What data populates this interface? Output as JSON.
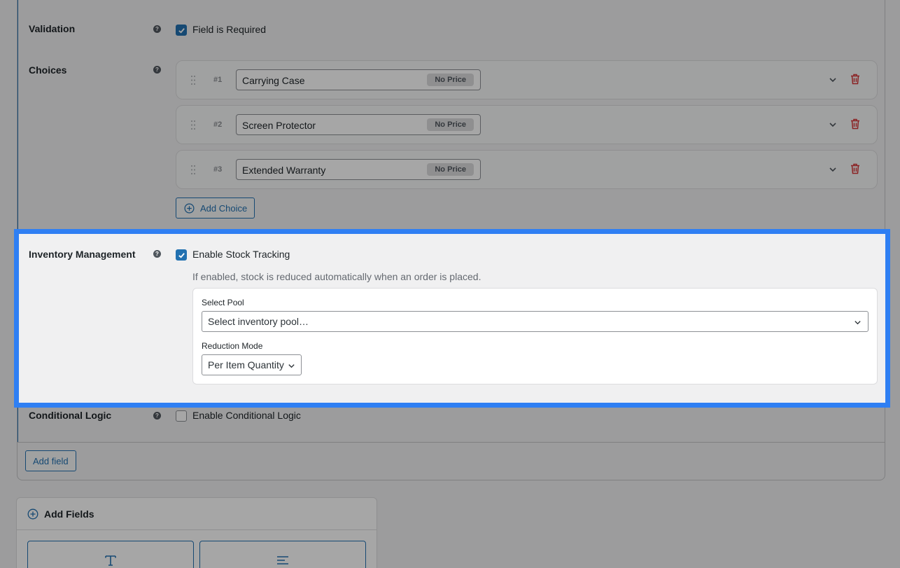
{
  "validation": {
    "label": "Validation",
    "checkbox_label": "Field is Required",
    "checked": true
  },
  "choices": {
    "label": "Choices",
    "items": [
      {
        "number": "#1",
        "value": "Carrying Case",
        "price": "No Price"
      },
      {
        "number": "#2",
        "value": "Screen Protector",
        "price": "No Price"
      },
      {
        "number": "#3",
        "value": "Extended Warranty",
        "price": "No Price"
      }
    ],
    "add_label": "Add Choice"
  },
  "inventory": {
    "label": "Inventory Management",
    "checkbox_label": "Enable Stock Tracking",
    "checked": true,
    "hint": "If enabled, stock is reduced automatically when an order is placed.",
    "pool_label": "Select Pool",
    "pool_placeholder": "Select inventory pool…",
    "mode_label": "Reduction Mode",
    "mode_value": "Per Item Quantity"
  },
  "conditional": {
    "label": "Conditional Logic",
    "checkbox_label": "Enable Conditional Logic",
    "checked": false
  },
  "add_field_label": "Add field",
  "add_fields": {
    "title": "Add Fields"
  },
  "colors": {
    "accent": "#2271b1",
    "highlight": "#2f7ff3",
    "danger": "#d63638"
  }
}
